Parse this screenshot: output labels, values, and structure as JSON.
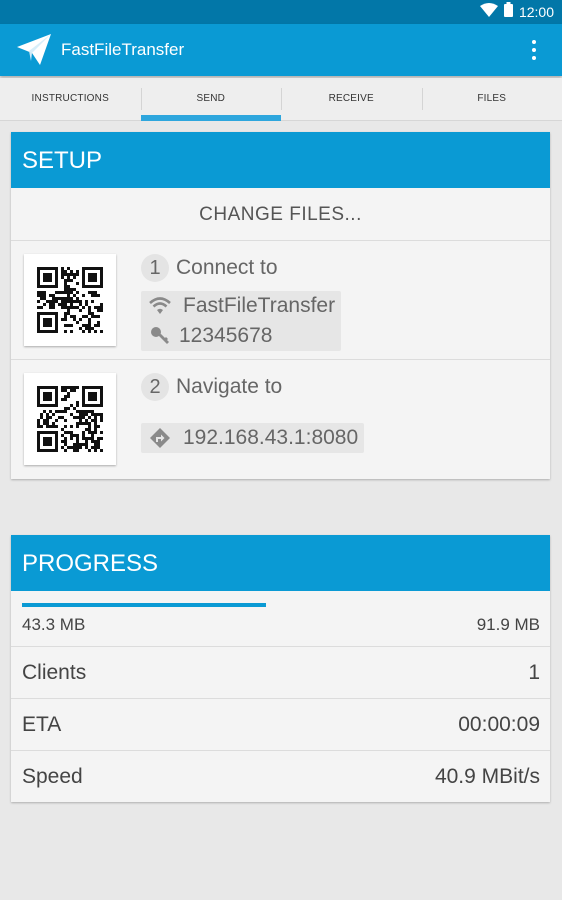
{
  "status_bar": {
    "time": "12:00"
  },
  "app_bar": {
    "title": "FastFileTransfer"
  },
  "tabs": [
    {
      "label": "INSTRUCTIONS",
      "active": false
    },
    {
      "label": "SEND",
      "active": true
    },
    {
      "label": "RECEIVE",
      "active": false
    },
    {
      "label": "FILES",
      "active": false
    }
  ],
  "setup": {
    "header": "SETUP",
    "change_files": "CHANGE FILES...",
    "step1": {
      "number": "1",
      "title": "Connect to",
      "ssid": "FastFileTransfer",
      "password": "12345678"
    },
    "step2": {
      "number": "2",
      "title": "Navigate to",
      "address": "192.168.43.1:8080"
    }
  },
  "progress": {
    "header": "PROGRESS",
    "transferred": "43.3 MB",
    "total": "91.9 MB",
    "fraction": 0.471,
    "stats": [
      {
        "label": "Clients",
        "value": "1"
      },
      {
        "label": "ETA",
        "value": "00:00:09"
      },
      {
        "label": "Speed",
        "value": "40.9 MBit/s"
      }
    ]
  },
  "colors": {
    "accent": "#0a9ad4",
    "status_bar": "#0277a8",
    "tab_indicator": "#2ea6dd"
  },
  "icons": {
    "app_logo": "paper-plane-icon",
    "overflow": "more-vert-icon",
    "wifi": "wifi-icon",
    "key": "key-icon",
    "directions": "directions-icon"
  }
}
